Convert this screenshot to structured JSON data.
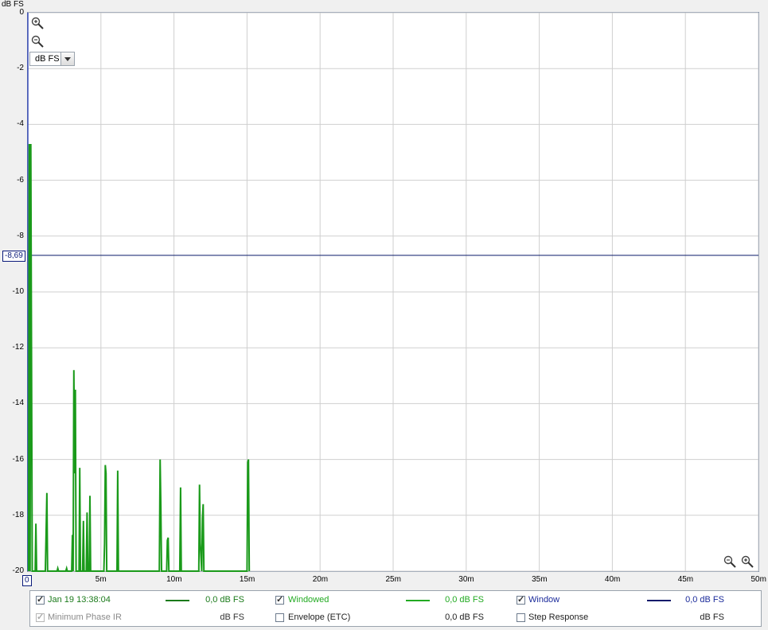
{
  "y_unit_label": "dB FS",
  "units_select": "dB FS",
  "cursor_readout": "-8,69",
  "x_origin_label": "0",
  "chart_data": {
    "type": "line",
    "y_ticks": [
      "0",
      "-2",
      "-4",
      "-6",
      "-8",
      "-10",
      "-12",
      "-14",
      "-16",
      "-18",
      "-20"
    ],
    "x_ticks": [
      "5m",
      "10m",
      "15m",
      "20m",
      "25m",
      "30m",
      "35m",
      "40m",
      "45m",
      "50m"
    ],
    "xlim": [
      0,
      50
    ],
    "ylim": [
      -20,
      0
    ],
    "grid": true,
    "cursor_level": -8.69,
    "series": [
      {
        "color": "#1a9a1a",
        "points": [
          [
            0.05,
            -20
          ],
          [
            0.1,
            -4.7
          ],
          [
            0.15,
            -20
          ],
          [
            0.2,
            -4.7
          ],
          [
            0.3,
            -20
          ],
          [
            0.5,
            -20
          ],
          [
            0.55,
            -18.3
          ],
          [
            0.6,
            -20
          ],
          [
            1.2,
            -20
          ],
          [
            1.3,
            -17.2
          ],
          [
            1.35,
            -20
          ],
          [
            2.0,
            -20
          ],
          [
            2.05,
            -19.9
          ],
          [
            2.1,
            -20
          ],
          [
            2.6,
            -20
          ],
          [
            2.65,
            -19.9
          ],
          [
            2.7,
            -20
          ],
          [
            3.0,
            -20
          ],
          [
            3.05,
            -18.7
          ],
          [
            3.1,
            -20
          ],
          [
            3.15,
            -12.8
          ],
          [
            3.2,
            -16.5
          ],
          [
            3.25,
            -13.5
          ],
          [
            3.3,
            -20
          ],
          [
            3.5,
            -20
          ],
          [
            3.55,
            -16.3
          ],
          [
            3.6,
            -20
          ],
          [
            3.75,
            -20
          ],
          [
            3.8,
            -18.2
          ],
          [
            3.85,
            -20
          ],
          [
            4.0,
            -20
          ],
          [
            4.05,
            -17.9
          ],
          [
            4.1,
            -20
          ],
          [
            4.2,
            -20
          ],
          [
            4.25,
            -17.3
          ],
          [
            4.3,
            -20
          ],
          [
            5.2,
            -20
          ],
          [
            5.25,
            -19.0
          ],
          [
            5.3,
            -16.2
          ],
          [
            5.35,
            -16.5
          ],
          [
            5.4,
            -20
          ],
          [
            6.1,
            -20
          ],
          [
            6.15,
            -16.4
          ],
          [
            6.2,
            -20
          ],
          [
            9.0,
            -20
          ],
          [
            9.05,
            -16.0
          ],
          [
            9.1,
            -17.7
          ],
          [
            9.15,
            -20
          ],
          [
            9.5,
            -20
          ],
          [
            9.55,
            -18.9
          ],
          [
            9.6,
            -18.8
          ],
          [
            9.65,
            -20
          ],
          [
            10.4,
            -20
          ],
          [
            10.45,
            -17.0
          ],
          [
            10.5,
            -20
          ],
          [
            11.7,
            -20
          ],
          [
            11.75,
            -16.9
          ],
          [
            11.8,
            -19.0
          ],
          [
            11.9,
            -20
          ],
          [
            11.95,
            -18.1
          ],
          [
            12.0,
            -17.6
          ],
          [
            12.05,
            -20
          ],
          [
            15.0,
            -20
          ],
          [
            15.05,
            -16.1
          ],
          [
            15.1,
            -16.0
          ],
          [
            15.15,
            -20
          ]
        ]
      }
    ]
  },
  "legend": {
    "row1": [
      {
        "label": "Jan 19 13:38:04",
        "checked": true,
        "color": "#1a7a1a",
        "swatch": "#1a7a1a",
        "value": "0,0 dB FS",
        "value_color": "#1a7a1a"
      },
      {
        "label": "Windowed",
        "checked": true,
        "color": "#22aa22",
        "swatch": "#22aa22",
        "value": "0,0 dB FS",
        "value_color": "#22aa22"
      },
      {
        "label": "Window",
        "checked": true,
        "color": "#1a2a9a",
        "swatch": "#0a1a6a",
        "value": "0,0 dB FS",
        "value_color": "#1a2a9a"
      }
    ],
    "row2": [
      {
        "label": "Minimum Phase IR",
        "checked": true,
        "disabled": true,
        "color": "#8a8a8a",
        "value": "dB FS",
        "value_color": "#333"
      },
      {
        "label": "Envelope (ETC)",
        "checked": false,
        "color": "#222",
        "value": "0,0 dB FS",
        "value_color": "#222"
      },
      {
        "label": "Step Response",
        "checked": false,
        "color": "#222",
        "value": "dB FS",
        "value_color": "#222"
      }
    ]
  }
}
